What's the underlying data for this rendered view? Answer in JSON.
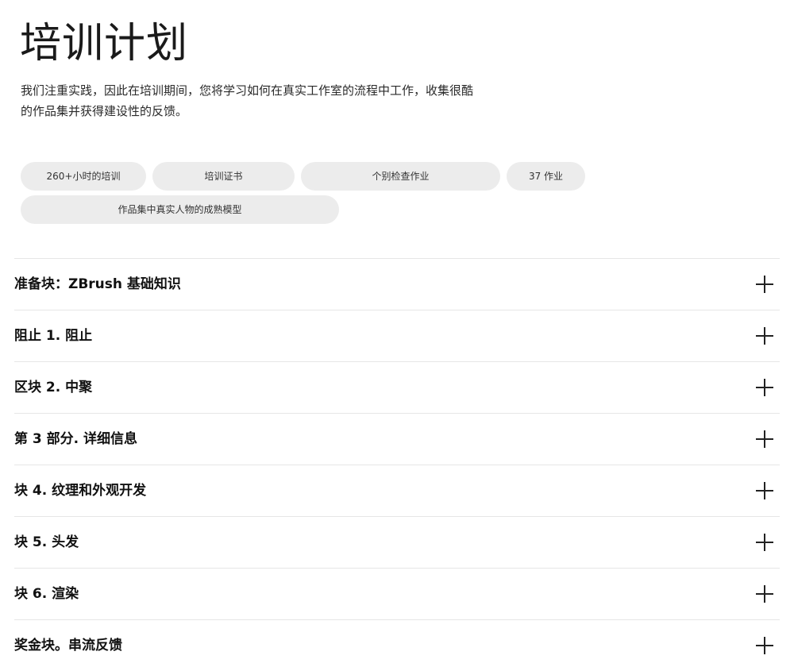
{
  "page": {
    "title": "培训计划",
    "intro": "我们注重实践，因此在培训期间，您将学习如何在真实工作室的流程中工作，收集很酷的作品集并获得建设性的反馈。"
  },
  "tags": [
    "260+小时的培训",
    "培训证书",
    "个别检查作业",
    "37 作业",
    "作品集中真实人物的成熟模型"
  ],
  "program": {
    "blocks": [
      {
        "title": "准备块：ZBrush 基础知识",
        "expand_icon": "plus-icon"
      },
      {
        "title": "阻止 1. 阻止",
        "expand_icon": "plus-icon"
      },
      {
        "title": "区块 2. 中聚",
        "expand_icon": "plus-icon"
      },
      {
        "title": "第 3 部分. 详细信息",
        "expand_icon": "plus-icon"
      },
      {
        "title": "块 4. 纹理和外观开发",
        "expand_icon": "plus-icon"
      },
      {
        "title": "块 5. 头发",
        "expand_icon": "plus-icon"
      },
      {
        "title": "块 6. 渲染",
        "expand_icon": "plus-icon"
      },
      {
        "title": "奖金块。串流反馈",
        "expand_icon": "plus-icon"
      }
    ]
  },
  "colors": {
    "tag_background": "#ececec",
    "divider": "#e6e6e6",
    "text": "#1a1a1a"
  }
}
